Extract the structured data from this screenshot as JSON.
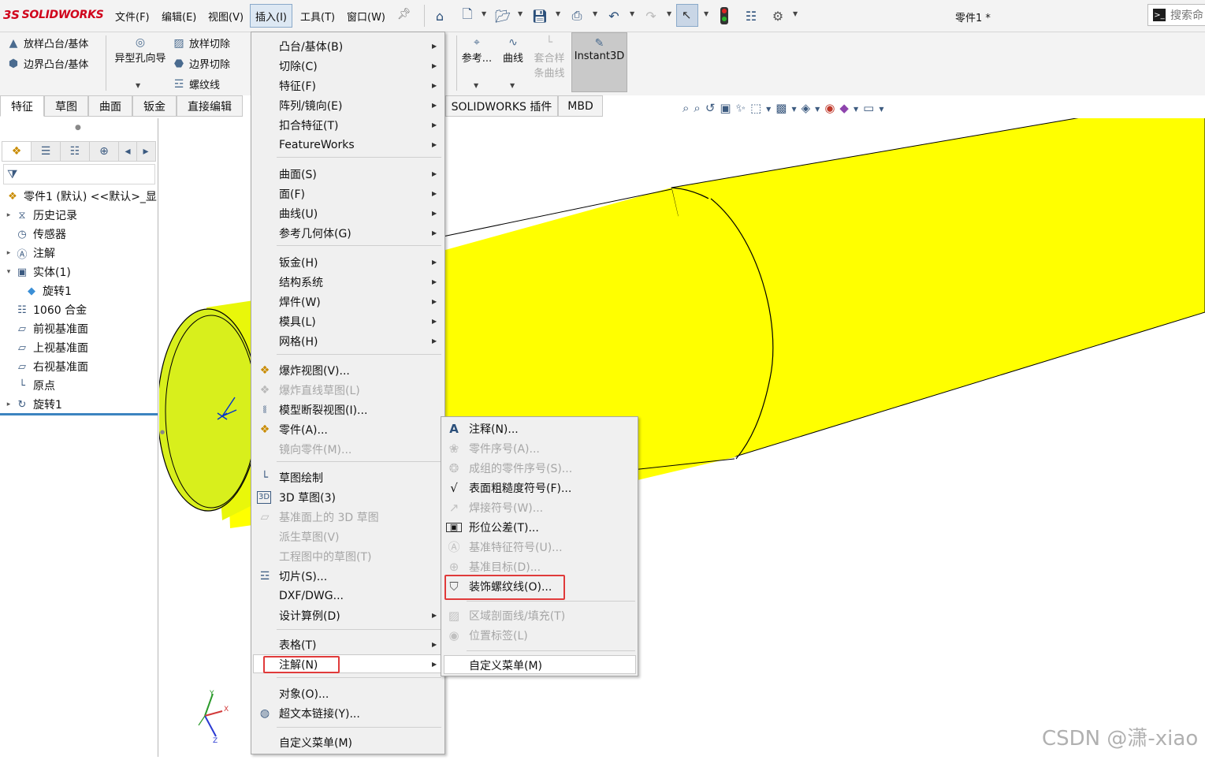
{
  "app": {
    "logo_mark": "3S",
    "logo_text": "SOLIDWORKS",
    "document_title": "零件1 *",
    "search_placeholder": "搜索命"
  },
  "menubar": {
    "items": [
      "文件(F)",
      "编辑(E)",
      "视图(V)",
      "插入(I)",
      "工具(T)",
      "窗口(W)"
    ],
    "active": "插入(I)"
  },
  "toolbar": {
    "icons": [
      "home-icon",
      "new-document-icon",
      "open-icon",
      "save-icon",
      "print-icon",
      "undo-icon",
      "redo-icon",
      "select-icon",
      "traffic-light-icon",
      "file-properties-icon",
      "options-gear-icon"
    ]
  },
  "command_manager": {
    "loft_boss": "放样凸台/基体",
    "boundary_boss": "边界凸台/基体",
    "hole_wizard": "异型孔向导",
    "loft_cut": "放样切除",
    "boundary_cut": "边界切除",
    "thread": "螺纹线",
    "reference": "参考...",
    "curves": "曲线",
    "fit_spline_line1": "套合样",
    "fit_spline_line2": "条曲线",
    "instant3d": "Instant3D"
  },
  "tabs": [
    "特征",
    "草图",
    "曲面",
    "钣金",
    "直接编辑",
    "SOLIDWORKS 插件",
    "MBD"
  ],
  "feature_tree": {
    "root": "零件1 (默认) <<默认>_显",
    "items": [
      {
        "label": "历史记录",
        "icon": "history-icon",
        "expandable": true
      },
      {
        "label": "传感器",
        "icon": "sensor-icon",
        "expandable": false
      },
      {
        "label": "注解",
        "icon": "annotation-icon",
        "expandable": true
      },
      {
        "label": "实体(1)",
        "icon": "solid-bodies-icon",
        "expandable": true,
        "expanded": true
      },
      {
        "label": "旋转1",
        "icon": "body-icon",
        "child": true
      },
      {
        "label": "1060 合金",
        "icon": "material-icon",
        "expandable": false
      },
      {
        "label": "前视基准面",
        "icon": "plane-icon",
        "expandable": false
      },
      {
        "label": "上视基准面",
        "icon": "plane-icon",
        "expandable": false
      },
      {
        "label": "右视基准面",
        "icon": "plane-icon",
        "expandable": false
      },
      {
        "label": "原点",
        "icon": "origin-icon",
        "expandable": false
      },
      {
        "label": "旋转1",
        "icon": "revolve-icon",
        "expandable": true
      }
    ]
  },
  "insert_menu": {
    "items": [
      {
        "label": "凸台/基体(B)",
        "sub": true
      },
      {
        "label": "切除(C)",
        "sub": true
      },
      {
        "label": "特征(F)",
        "sub": true
      },
      {
        "label": "阵列/镜向(E)",
        "sub": true
      },
      {
        "label": "扣合特征(T)",
        "sub": true
      },
      {
        "label": "FeatureWorks",
        "sub": true
      },
      {
        "label": "曲面(S)",
        "sub": true
      },
      {
        "label": "面(F)",
        "sub": true
      },
      {
        "label": "曲线(U)",
        "sub": true
      },
      {
        "label": "参考几何体(G)",
        "sub": true
      },
      {
        "label": "钣金(H)",
        "sub": true
      },
      {
        "label": "结构系统",
        "sub": true
      },
      {
        "label": "焊件(W)",
        "sub": true
      },
      {
        "label": "模具(L)",
        "sub": true
      },
      {
        "label": "网格(H)",
        "sub": true
      },
      {
        "label": "爆炸视图(V)...",
        "icon": "explode-view-icon"
      },
      {
        "label": "爆炸直线草图(L)",
        "disabled": true,
        "icon": "explode-line-icon"
      },
      {
        "label": "模型断裂视图(I)...",
        "icon": "break-view-icon"
      },
      {
        "label": "零件(A)...",
        "icon": "insert-part-icon"
      },
      {
        "label": "镜向零件(M)...",
        "disabled": true
      },
      {
        "label": "草图绘制",
        "icon": "sketch-icon"
      },
      {
        "label": "3D 草图(3)",
        "icon": "3d-sketch-icon"
      },
      {
        "label": "基准面上的 3D 草图",
        "disabled": true,
        "icon": "3d-sketch-on-plane-icon"
      },
      {
        "label": "派生草图(V)",
        "disabled": true
      },
      {
        "label": "工程图中的草图(T)",
        "disabled": true
      },
      {
        "label": "切片(S)...",
        "icon": "slice-icon"
      },
      {
        "label": "DXF/DWG..."
      },
      {
        "label": "设计算例(D)",
        "sub": true
      },
      {
        "label": "表格(T)",
        "sub": true
      },
      {
        "label": "注解(N)",
        "sub": true,
        "highlighted": true
      },
      {
        "label": "对象(O)..."
      },
      {
        "label": "超文本链接(Y)...",
        "icon": "hyperlink-icon"
      },
      {
        "label": "自定义菜单(M)"
      }
    ]
  },
  "annotation_submenu": {
    "items": [
      {
        "label": "注释(N)...",
        "icon": "note-icon"
      },
      {
        "label": "零件序号(A)...",
        "disabled": true,
        "icon": "balloon-icon"
      },
      {
        "label": "成组的零件序号(S)...",
        "disabled": true,
        "icon": "stacked-balloon-icon"
      },
      {
        "label": "表面粗糙度符号(F)...",
        "icon": "surface-finish-icon"
      },
      {
        "label": "焊接符号(W)...",
        "disabled": true,
        "icon": "weld-symbol-icon"
      },
      {
        "label": "形位公差(T)...",
        "icon": "geometric-tolerance-icon"
      },
      {
        "label": "基准特征符号(U)...",
        "disabled": true,
        "icon": "datum-feature-icon"
      },
      {
        "label": "基准目标(D)...",
        "disabled": true,
        "icon": "datum-target-icon"
      },
      {
        "label": "装饰螺纹线(O)...",
        "icon": "cosmetic-thread-icon",
        "boxed": true
      },
      {
        "label": "区域剖面线/填充(T)",
        "disabled": true,
        "icon": "hatch-icon"
      },
      {
        "label": "位置标签(L)",
        "disabled": true,
        "icon": "location-label-icon"
      },
      {
        "label": "自定义菜单(M)",
        "highlighted": true
      }
    ]
  },
  "triad": {
    "x": "X",
    "y": "Y",
    "z": "Z"
  },
  "watermark": "CSDN @潇-xiao",
  "colors": {
    "model_yellow": "#ffff00",
    "model_end_face": "#d8ef1c",
    "selection_red": "#e03a3a",
    "logo_red": "#d0021b"
  }
}
